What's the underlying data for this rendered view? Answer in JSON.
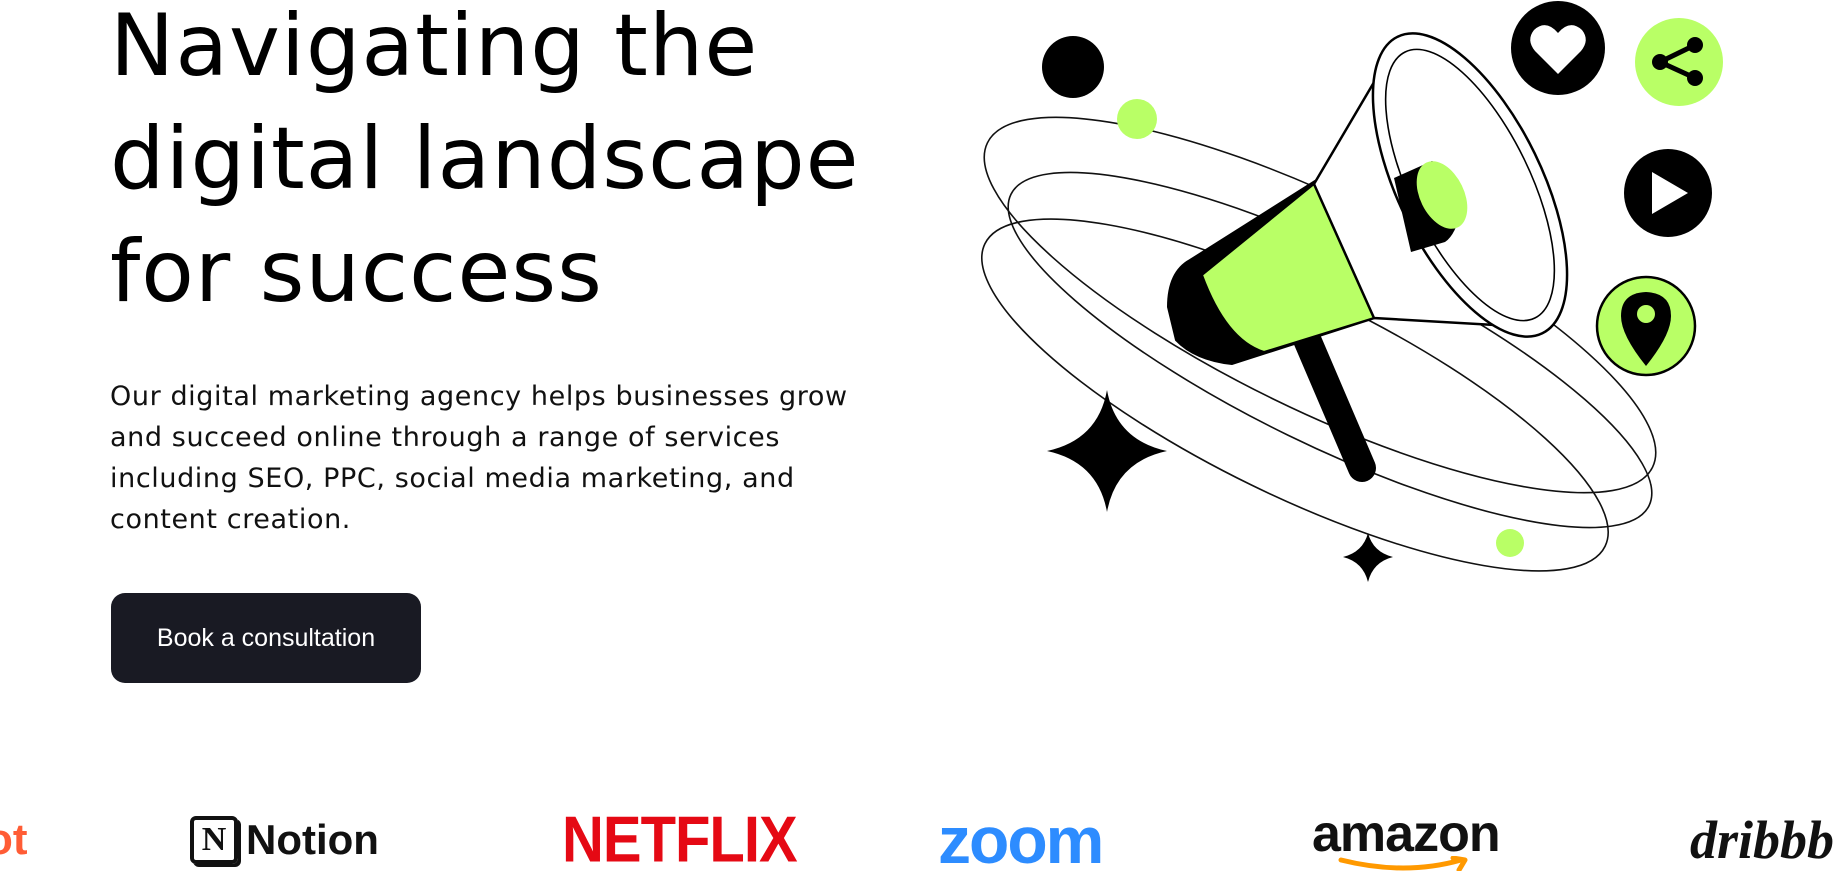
{
  "hero": {
    "headline": "Navigating the digital landscape for success",
    "description": "Our digital marketing agency helps businesses grow and succeed online through a range of services including SEO, PPC, social media marketing, and content creation.",
    "cta_label": "Book a consultation"
  },
  "illustration": {
    "icons": [
      "megaphone-icon",
      "heart-icon",
      "share-icon",
      "play-icon",
      "location-pin-icon",
      "sparkle-icon"
    ]
  },
  "logos": {
    "items": [
      "HubSpot",
      "Notion",
      "NETFLIX",
      "zoom",
      "amazon",
      "dribbble"
    ],
    "hubspot_visible": "ot",
    "notion_mark": "N",
    "notion_text": "Notion",
    "netflix_text": "NETFLIX",
    "zoom_text": "zoom",
    "amazon_text": "amazon",
    "dribbble_visible": "dribbb"
  },
  "colors": {
    "accent": "#b9ff66",
    "dark": "#191a23",
    "netflix": "#e50914",
    "zoom": "#2d8cff",
    "hubspot": "#ff5c35",
    "amazon_smile": "#ff9900"
  }
}
